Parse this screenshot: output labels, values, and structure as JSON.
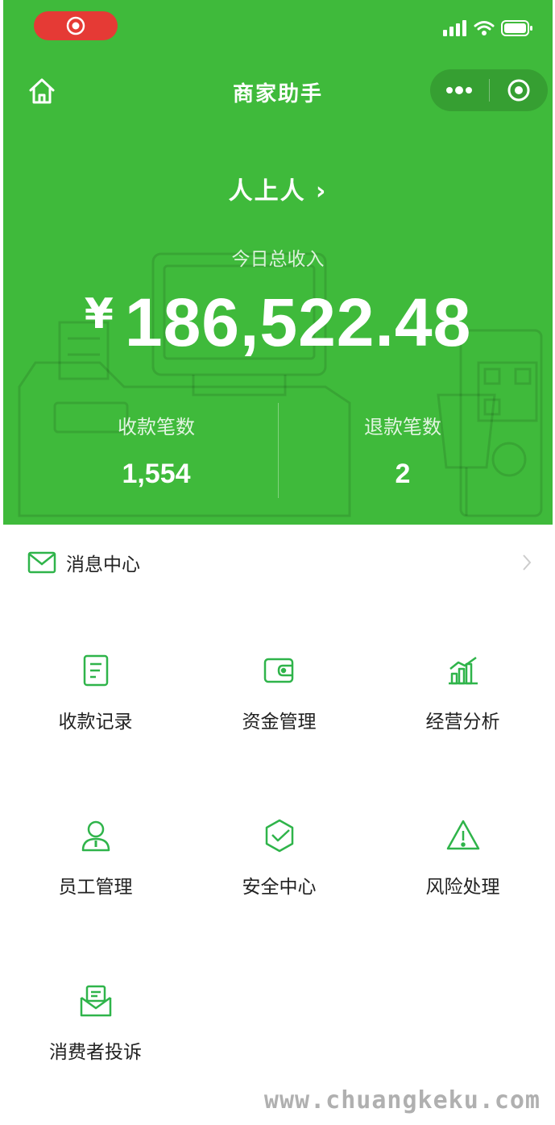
{
  "nav": {
    "title": "商家助手"
  },
  "store": {
    "name": "人上人 ›"
  },
  "income": {
    "label": "今日总收入",
    "currency": "¥",
    "amount": "186,522.48"
  },
  "stats": {
    "payments": {
      "label": "收款笔数",
      "value": "1,554"
    },
    "refunds": {
      "label": "退款笔数",
      "value": "2"
    }
  },
  "message_center": {
    "label": "消息中心"
  },
  "menu": {
    "items": [
      {
        "label": "收款记录",
        "icon": "receipt-icon"
      },
      {
        "label": "资金管理",
        "icon": "wallet-icon"
      },
      {
        "label": "经营分析",
        "icon": "chart-icon"
      },
      {
        "label": "员工管理",
        "icon": "staff-icon"
      },
      {
        "label": "安全中心",
        "icon": "shield-icon"
      },
      {
        "label": "风险处理",
        "icon": "warning-icon"
      },
      {
        "label": "消费者投诉",
        "icon": "complaint-mail-icon"
      }
    ]
  },
  "watermark": "www.chuangkeku.com",
  "colors": {
    "brand_green": "#3fba3b",
    "icon_green": "#2fb44a",
    "record_red": "#e53a35"
  }
}
